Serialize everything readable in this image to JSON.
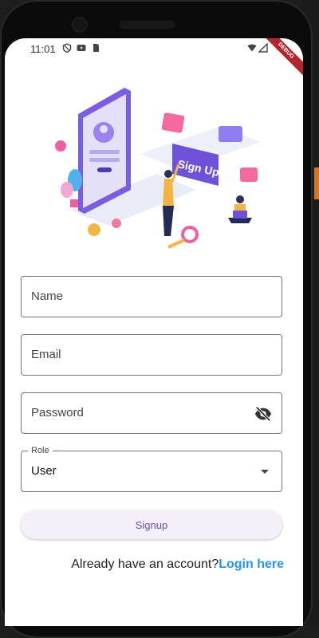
{
  "status_bar": {
    "time": "11:01",
    "debug_label": "DEBUG"
  },
  "form": {
    "name_placeholder": "Name",
    "email_placeholder": "Email",
    "password_placeholder": "Password",
    "role_label": "Role",
    "role_value": "User"
  },
  "illustration": {
    "banner_text": "Sign Up"
  },
  "signup_button": {
    "label": "Signup"
  },
  "footer": {
    "prompt": "Already have an account?",
    "login_link": "Login here"
  },
  "colors": {
    "accent": "#2196f3",
    "button_bg": "#f4eff8",
    "button_text": "#6a4fa3",
    "illustration_primary": "#7c5ce0"
  }
}
